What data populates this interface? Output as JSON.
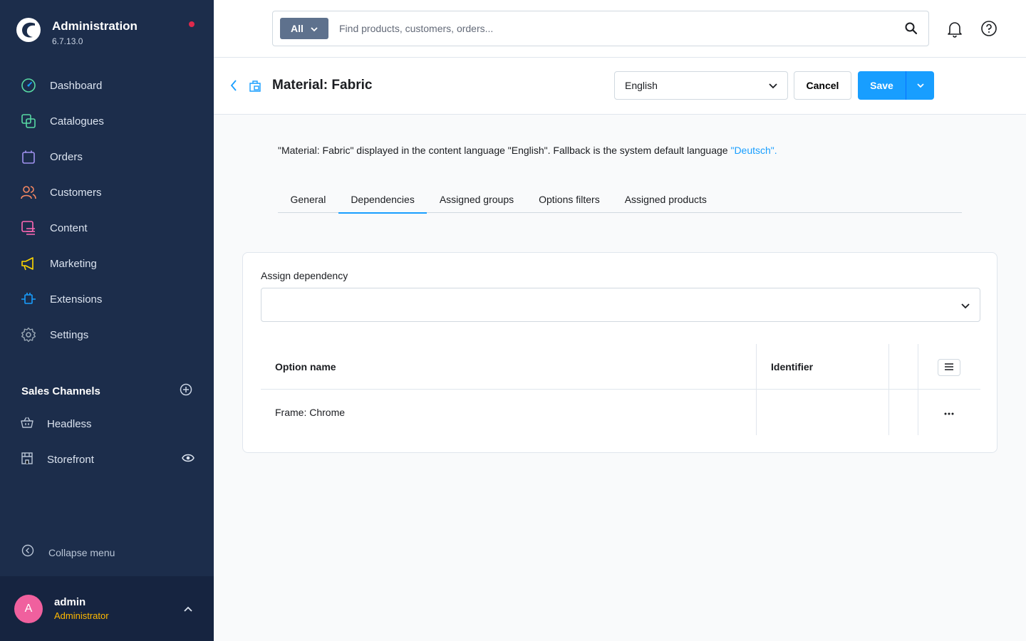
{
  "app": {
    "title": "Administration",
    "version": "6.7.13.0"
  },
  "nav": {
    "items": [
      {
        "label": "Dashboard",
        "icon": "dashboard-icon",
        "color": "#57d9a3"
      },
      {
        "label": "Catalogues",
        "icon": "catalogues-icon",
        "color": "#57d9a3"
      },
      {
        "label": "Orders",
        "icon": "orders-icon",
        "color": "#a092f0"
      },
      {
        "label": "Customers",
        "icon": "customers-icon",
        "color": "#f88962"
      },
      {
        "label": "Content",
        "icon": "content-icon",
        "color": "#ff68b4"
      },
      {
        "label": "Marketing",
        "icon": "marketing-icon",
        "color": "#ffd700"
      },
      {
        "label": "Extensions",
        "icon": "extensions-icon",
        "color": "#189eff"
      },
      {
        "label": "Settings",
        "icon": "settings-icon",
        "color": "#9aa8b5"
      }
    ]
  },
  "sales_channels": {
    "title": "Sales Channels",
    "items": [
      {
        "label": "Headless",
        "icon": "basket-icon"
      },
      {
        "label": "Storefront",
        "icon": "storefront-icon"
      }
    ]
  },
  "collapse_label": "Collapse menu",
  "user": {
    "initial": "A",
    "name": "admin",
    "role": "Administrator"
  },
  "search": {
    "type_label": "All",
    "placeholder": "Find products, customers, orders..."
  },
  "header": {
    "title": "Material: Fabric",
    "language": "English",
    "cancel_label": "Cancel",
    "save_label": "Save"
  },
  "info": {
    "text": "\"Material: Fabric\" displayed in the content language \"English\". Fallback is the system default language ",
    "link": "\"Deutsch\"."
  },
  "tabs": [
    {
      "label": "General",
      "active": false
    },
    {
      "label": "Dependencies",
      "active": true
    },
    {
      "label": "Assigned groups",
      "active": false
    },
    {
      "label": "Options filters",
      "active": false
    },
    {
      "label": "Assigned products",
      "active": false
    }
  ],
  "dependency": {
    "label": "Assign dependency",
    "value": ""
  },
  "grid": {
    "columns": [
      "Option name",
      "Identifier"
    ],
    "rows": [
      {
        "name": "Frame: Chrome",
        "identifier": ""
      }
    ]
  },
  "colors": {
    "sidebar": "#1c2d4b",
    "accent": "#189eff",
    "role": "#ffb900",
    "avatar": "#f0609e",
    "notification": "#de294c"
  }
}
